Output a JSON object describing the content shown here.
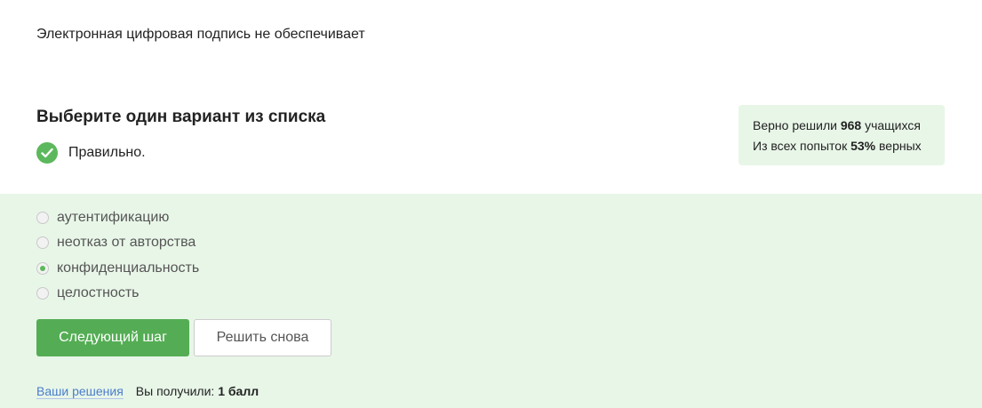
{
  "question": "Электронная цифровая подпись не обеспечивает",
  "instruction": "Выберите один вариант из списка",
  "result": "Правильно.",
  "stats": {
    "line1_prefix": "Верно решили",
    "solved_count": "968",
    "line1_suffix": "учащихся",
    "line2_prefix": "Из всех попыток",
    "percent": "53%",
    "line2_suffix": "верных"
  },
  "options": [
    {
      "label": "аутентификацию",
      "checked": false
    },
    {
      "label": "неотказ от авторства",
      "checked": false
    },
    {
      "label": "конфиденциальность",
      "checked": true
    },
    {
      "label": "целостность",
      "checked": false
    }
  ],
  "buttons": {
    "next": "Следующий шаг",
    "retry": "Решить снова"
  },
  "footer": {
    "solutions_link": "Ваши решения",
    "got_prefix": "Вы получили:",
    "score": "1 балл"
  },
  "colors": {
    "accent": "#54ad54",
    "panel_bg": "#e8f6e8",
    "link": "#4a7dcc"
  }
}
